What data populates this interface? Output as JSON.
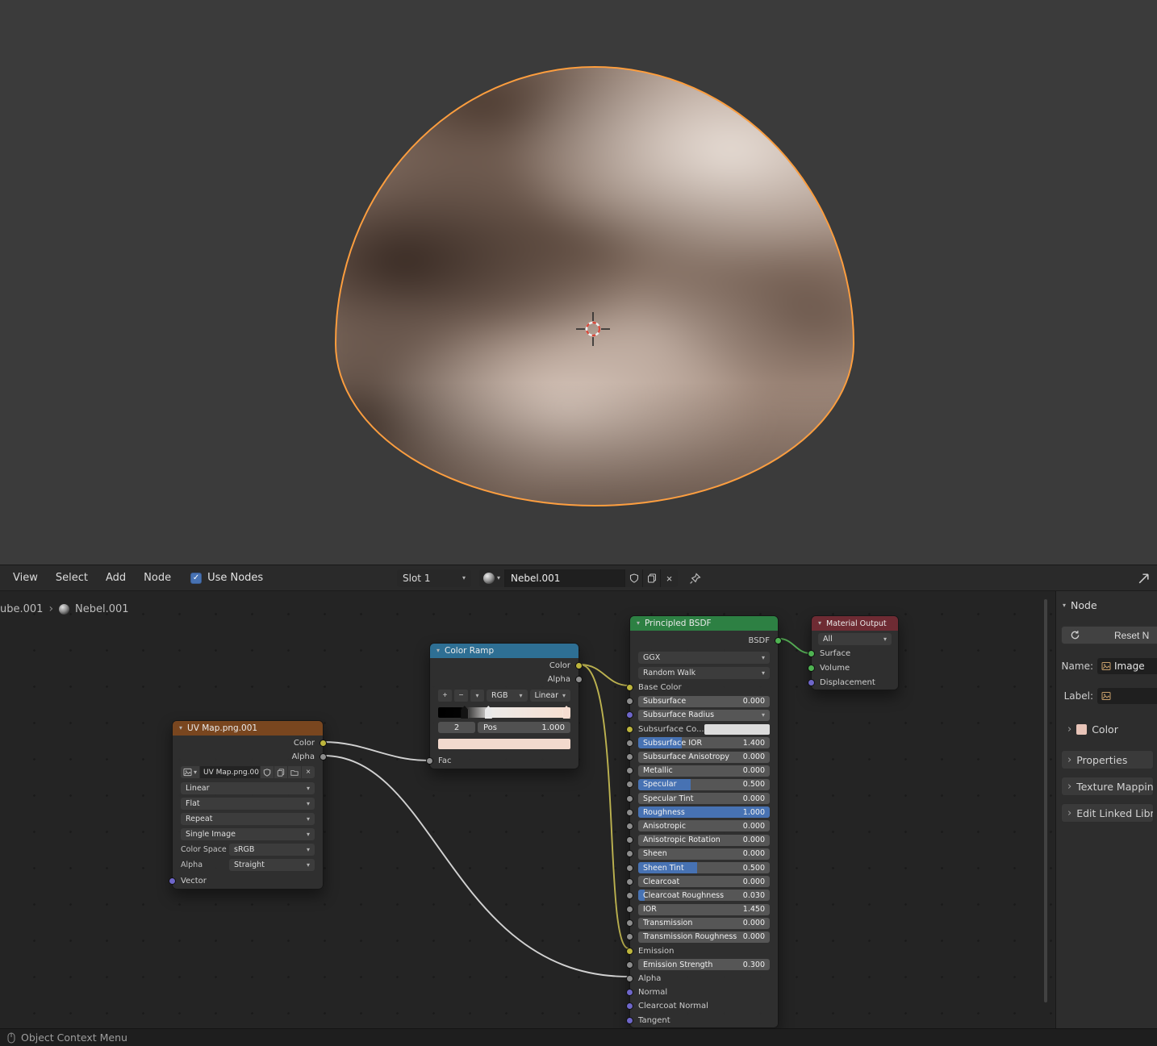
{
  "colors": {
    "accent_blue": "#4772b3",
    "selection_orange": "#ff9e3d",
    "link_yellow": "#bdb350",
    "link_white": "#d2d2d2",
    "link_green": "#55ad55"
  },
  "header": {
    "menus": [
      "View",
      "Select",
      "Add",
      "Node"
    ],
    "use_nodes_label": "Use Nodes",
    "use_nodes_checked": true,
    "slot": "Slot 1",
    "material_name": "Nebel.001"
  },
  "breadcrumb": {
    "object": "ube.001",
    "material": "Nebel.001"
  },
  "nodes": {
    "uv_map": {
      "title": "UV Map.png.001",
      "outputs": [
        {
          "label": "Color",
          "color": "yellow"
        },
        {
          "label": "Alpha",
          "color": "gray"
        }
      ],
      "image_name": "UV Map.png.001",
      "dropdowns": [
        "Linear",
        "Flat",
        "Repeat",
        "Single Image"
      ],
      "color_space_label": "Color Space",
      "color_space_value": "sRGB",
      "alpha_label": "Alpha",
      "alpha_value": "Straight",
      "input": {
        "label": "Vector",
        "color": "purple"
      }
    },
    "color_ramp": {
      "title": "Color Ramp",
      "outputs": [
        {
          "label": "Color",
          "color": "yellow"
        },
        {
          "label": "Alpha",
          "color": "gray"
        }
      ],
      "add_label": "+",
      "remove_label": "−",
      "mode": "RGB",
      "interpolation": "Linear",
      "index": "2",
      "pos_label": "Pos",
      "pos_value": "1.000",
      "swatch": "#f2d9cd",
      "stops": [
        {
          "pos": 0.2,
          "color": "#131313",
          "selected": false
        },
        {
          "pos": 0.38,
          "color": "#e9e9e9",
          "selected": false
        },
        {
          "pos": 0.97,
          "color": "#f6ddd1",
          "selected": true
        }
      ],
      "input": {
        "label": "Fac",
        "color": "gray"
      }
    },
    "principled": {
      "title": "Principled BSDF",
      "output": "BSDF",
      "distribution": "GGX",
      "subsurface_method": "Random Walk",
      "rows": [
        {
          "label": "Base Color",
          "type": "socket",
          "socket": "yellow"
        },
        {
          "label": "Subsurface",
          "value": "0.000",
          "type": "slider",
          "fill": 0,
          "socket": "gray"
        },
        {
          "label": "Subsurface Radius",
          "type": "dropdown",
          "socket": "purple"
        },
        {
          "label": "Subsurface Co...",
          "type": "color",
          "swatch": "#dcdcdc",
          "socket": "yellow"
        },
        {
          "label": "Subsurface IOR",
          "value": "1.400",
          "type": "slider",
          "fill": 0.33,
          "socket": "gray"
        },
        {
          "label": "Subsurface Anisotropy",
          "value": "0.000",
          "type": "slider",
          "fill": 0,
          "socket": "gray"
        },
        {
          "label": "Metallic",
          "value": "0.000",
          "type": "slider",
          "fill": 0,
          "socket": "gray"
        },
        {
          "label": "Specular",
          "value": "0.500",
          "type": "slider",
          "fill": 0.4,
          "socket": "gray"
        },
        {
          "label": "Specular Tint",
          "value": "0.000",
          "type": "slider",
          "fill": 0,
          "socket": "gray"
        },
        {
          "label": "Roughness",
          "value": "1.000",
          "type": "slider",
          "fill": 1,
          "socket": "gray"
        },
        {
          "label": "Anisotropic",
          "value": "0.000",
          "type": "slider",
          "fill": 0,
          "socket": "gray"
        },
        {
          "label": "Anisotropic Rotation",
          "value": "0.000",
          "type": "slider",
          "fill": 0,
          "socket": "gray"
        },
        {
          "label": "Sheen",
          "value": "0.000",
          "type": "slider",
          "fill": 0,
          "socket": "gray"
        },
        {
          "label": "Sheen Tint",
          "value": "0.500",
          "type": "slider",
          "fill": 0.45,
          "socket": "gray"
        },
        {
          "label": "Clearcoat",
          "value": "0.000",
          "type": "slider",
          "fill": 0,
          "socket": "gray"
        },
        {
          "label": "Clearcoat Roughness",
          "value": "0.030",
          "type": "slider",
          "fill": 0.05,
          "socket": "gray"
        },
        {
          "label": "IOR",
          "value": "1.450",
          "type": "slider",
          "fill": 0,
          "socket": "gray"
        },
        {
          "label": "Transmission",
          "value": "0.000",
          "type": "slider",
          "fill": 0,
          "socket": "gray"
        },
        {
          "label": "Transmission Roughness",
          "value": "0.000",
          "type": "slider",
          "fill": 0,
          "socket": "gray"
        },
        {
          "label": "Emission",
          "type": "socket",
          "socket": "yellow"
        },
        {
          "label": "Emission Strength",
          "value": "0.300",
          "type": "slider",
          "fill": 0,
          "socket": "gray"
        },
        {
          "label": "Alpha",
          "type": "socket",
          "socket": "gray"
        },
        {
          "label": "Normal",
          "type": "socket",
          "socket": "purple"
        },
        {
          "label": "Clearcoat Normal",
          "type": "socket",
          "socket": "purple"
        },
        {
          "label": "Tangent",
          "type": "socket",
          "socket": "purple"
        }
      ]
    },
    "material_output": {
      "title": "Material Output",
      "target": "All",
      "inputs": [
        {
          "label": "Surface",
          "color": "green"
        },
        {
          "label": "Volume",
          "color": "green"
        },
        {
          "label": "Displacement",
          "color": "purple"
        }
      ]
    }
  },
  "sidebar": {
    "tab": "Node",
    "reset_button": "Reset N",
    "name_label": "Name:",
    "name_value": "Image",
    "label_label": "Label:",
    "color_section": "Color",
    "color_swatch": "#e8c4b8",
    "panels": [
      "Properties",
      "Texture Mapping",
      "Edit Linked Libra"
    ]
  },
  "status_bar": {
    "text": "Object Context Menu"
  }
}
